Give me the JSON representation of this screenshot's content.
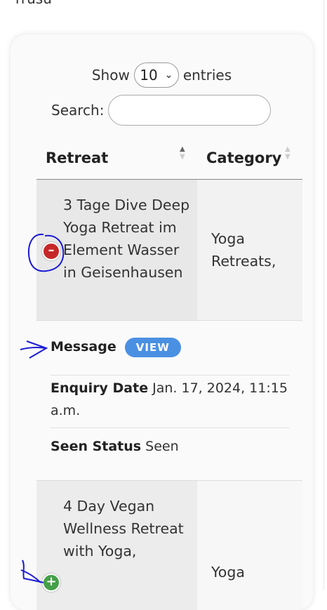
{
  "top_cut_text": "rrusu",
  "controls": {
    "show_label": "Show",
    "entries_value": "10",
    "entries_label": "entries",
    "search_label": "Search:",
    "search_value": ""
  },
  "table": {
    "columns": [
      "Retreat",
      "Category"
    ],
    "rows": [
      {
        "retreat": "3 Tage Dive Deep Yoga Retreat im Element Wasser in Geisenhausen",
        "category": "Yoga Retreats,",
        "expanded": true,
        "details": {
          "message_label": "Message",
          "view_label": "VIEW",
          "enquiry_label": "Enquiry Date",
          "enquiry_value": "Jan. 17, 2024, 11:15 a.m.",
          "seen_label": "Seen Status",
          "seen_value": "Seen"
        }
      },
      {
        "retreat": "4 Day Vegan Wellness Retreat with Yoga,",
        "category": "Yoga",
        "expanded": false
      }
    ]
  },
  "colors": {
    "collapse_button": "#c62828",
    "expand_button": "#43a047",
    "view_button": "#4a90e2",
    "annotation": "#1a1ad6"
  },
  "icons": [
    "collapse-minus-icon",
    "expand-plus-icon",
    "chevron-down-icon",
    "sort-arrows-icon"
  ]
}
